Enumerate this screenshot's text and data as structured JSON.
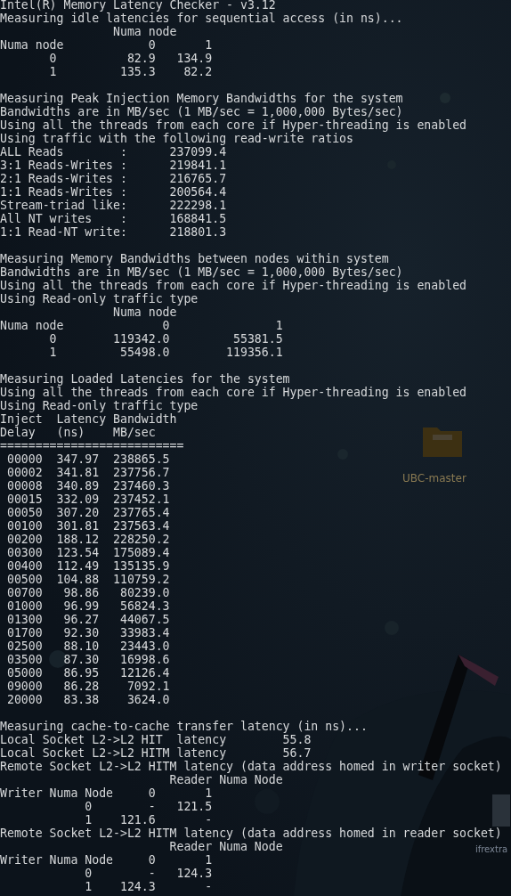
{
  "desktop_icons": [
    {
      "kind": "folder",
      "label": "UBC-master"
    },
    {
      "kind": "file",
      "label": "ifrextra"
    }
  ],
  "terminal": {
    "sections": [
      {
        "lines": [
          "Intel(R) Memory Latency Checker - v3.12",
          "Measuring idle latencies for sequential access (in ns)...",
          "                Numa node",
          "Numa node            0       1",
          "       0          82.9   134.9",
          "       1         135.3    82.2"
        ]
      },
      {
        "lines": [
          "Measuring Peak Injection Memory Bandwidths for the system",
          "Bandwidths are in MB/sec (1 MB/sec = 1,000,000 Bytes/sec)",
          "Using all the threads from each core if Hyper-threading is enabled",
          "Using traffic with the following read-write ratios",
          "ALL Reads        :      237099.4",
          "3:1 Reads-Writes :      219841.1",
          "2:1 Reads-Writes :      216765.7",
          "1:1 Reads-Writes :      200564.4",
          "Stream-triad like:      222298.1",
          "All NT writes    :      168841.5",
          "1:1 Read-NT write:      218801.3"
        ]
      },
      {
        "lines": [
          "Measuring Memory Bandwidths between nodes within system",
          "Bandwidths are in MB/sec (1 MB/sec = 1,000,000 Bytes/sec)",
          "Using all the threads from each core if Hyper-threading is enabled",
          "Using Read-only traffic type",
          "                Numa node",
          "Numa node              0               1",
          "       0        119342.0         55381.5",
          "       1         55498.0        119356.1"
        ]
      },
      {
        "lines": [
          "Measuring Loaded Latencies for the system",
          "Using all the threads from each core if Hyper-threading is enabled",
          "Using Read-only traffic type",
          "Inject  Latency Bandwidth",
          "Delay   (ns)    MB/sec",
          "==========================",
          " 00000  347.97  238865.5",
          " 00002  341.81  237756.7",
          " 00008  340.89  237460.3",
          " 00015  332.09  237452.1",
          " 00050  307.20  237765.4",
          " 00100  301.81  237563.4",
          " 00200  188.12  228250.2",
          " 00300  123.54  175089.4",
          " 00400  112.49  135135.9",
          " 00500  104.88  110759.2",
          " 00700   98.86   80239.0",
          " 01000   96.99   56824.3",
          " 01300   96.27   44067.5",
          " 01700   92.30   33983.4",
          " 02500   88.10   23443.0",
          " 03500   87.30   16998.6",
          " 05000   86.95   12126.4",
          " 09000   86.28    7092.1",
          " 20000   83.38    3624.0"
        ]
      },
      {
        "lines": [
          "Measuring cache-to-cache transfer latency (in ns)...",
          "Local Socket L2->L2 HIT  latency        55.8",
          "Local Socket L2->L2 HITM latency        56.7",
          "Remote Socket L2->L2 HITM latency (data address homed in writer socket)",
          "                        Reader Numa Node",
          "Writer Numa Node     0       1",
          "            0        -   121.5",
          "            1    121.6       -",
          "Remote Socket L2->L2 HITM latency (data address homed in reader socket)",
          "                        Reader Numa Node",
          "Writer Numa Node     0       1",
          "            0        -   124.3",
          "            1    124.3       -"
        ]
      }
    ]
  }
}
